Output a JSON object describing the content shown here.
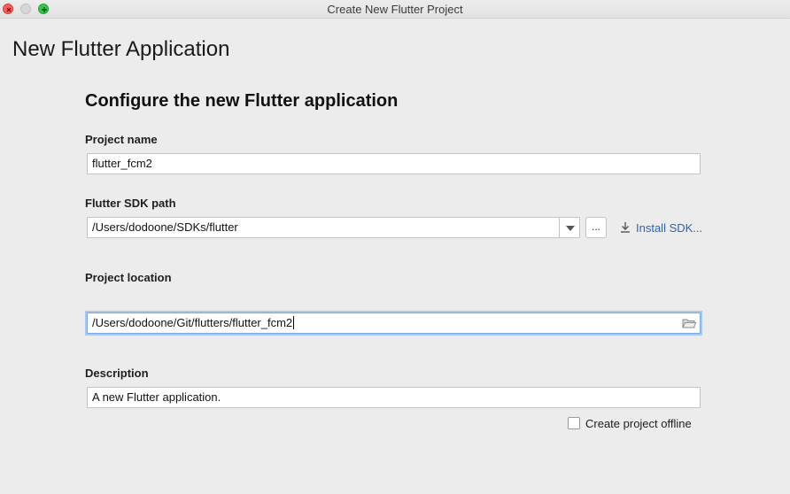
{
  "window": {
    "title": "Create New Flutter Project",
    "controls": [
      "close-icon",
      "minimize-icon",
      "maximize-icon"
    ]
  },
  "page": {
    "title": "New Flutter Application",
    "section_title": "Configure the new Flutter application"
  },
  "project_name": {
    "label": "Project name",
    "value": "flutter_fcm2"
  },
  "sdk_path": {
    "label": "Flutter SDK path",
    "value": "/Users/dodoone/SDKs/flutter",
    "browse_label": "...",
    "install_label": "Install SDK..."
  },
  "location": {
    "label": "Project location",
    "value": "/Users/dodoone/Git/flutters/flutter_fcm2"
  },
  "description": {
    "label": "Description",
    "value": "A new Flutter application."
  },
  "offline": {
    "label": "Create project offline",
    "checked": false
  },
  "colors": {
    "link": "#2a63b8",
    "focus": "#7aa9e6",
    "background": "#ececec"
  }
}
